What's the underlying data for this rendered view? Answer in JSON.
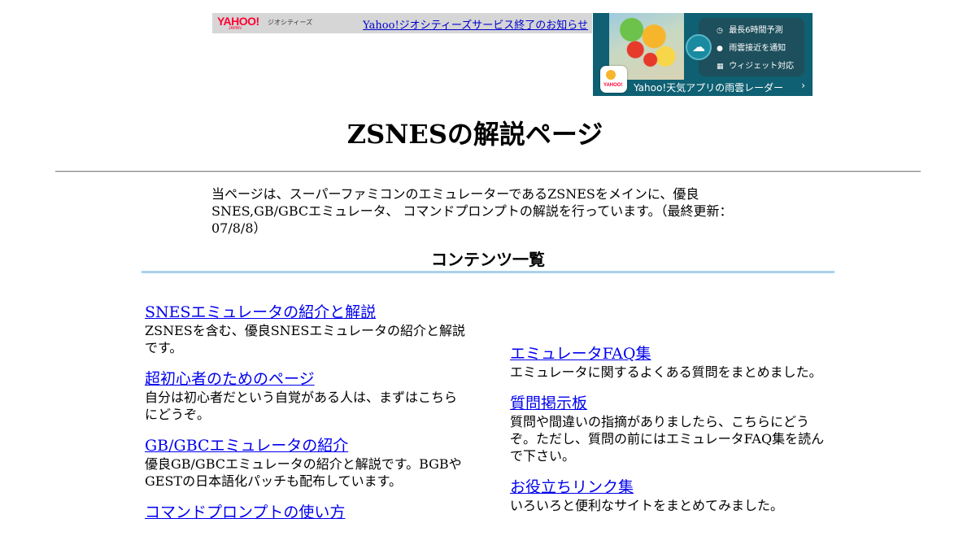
{
  "geocities_bar": {
    "logo_text": "YAHOO!",
    "logo_sub": "JAPAN",
    "logo_service": "ジオシティーズ",
    "notice_link": "Yahoo!ジオシティーズサービス終了のお知らせ"
  },
  "ad": {
    "features": [
      {
        "icon": "clock-icon",
        "glyph": "◷",
        "label": "最長6時間予測"
      },
      {
        "icon": "pin-icon",
        "glyph": "●",
        "label": "雨雲接近を通知"
      },
      {
        "icon": "widget-icon",
        "glyph": "▦",
        "label": "ウィジェット対応"
      }
    ],
    "app_icon_label": "YAHOO!",
    "cta": "Yahoo!天気アプリの雨雲レーダー",
    "chevron": "›"
  },
  "page": {
    "title": "ZSNESの解説ページ",
    "intro": "当ページは、スーパーファミコンのエミュレーターであるZSNESをメインに、優良SNES,GB/GBCエミュレータ、 コマンドプロンプトの解説を行っています。（最終更新：07/8/8）",
    "contents_heading": "コンテンツ一覧"
  },
  "contents": {
    "left": [
      {
        "link": "SNESエミュレータの紹介と解説",
        "desc": "ZSNESを含む、優良SNESエミュレータの紹介と解説です。"
      },
      {
        "link": "超初心者のためのページ",
        "desc": "自分は初心者だという自覚がある人は、まずはこちらにどうぞ。"
      },
      {
        "link": "GB/GBCエミュレータの紹介",
        "desc": "優良GB/GBCエミュレータの紹介と解説です。BGBやGESTの日本語化パッチも配布しています。"
      },
      {
        "link": "コマンドプロンプトの使い方",
        "desc": ""
      }
    ],
    "right": [
      {
        "link": "エミュレータFAQ集",
        "desc": "エミュレータに関するよくある質問をまとめました。"
      },
      {
        "link": "質問掲示板",
        "desc": "質問や間違いの指摘がありましたら、こちらにどうぞ。ただし、質問の前にはエミュレータFAQ集を読んで下さい。"
      },
      {
        "link": "お役立ちリンク集",
        "desc": "いろいろと便利なサイトをまとめてみました。"
      }
    ]
  },
  "colors": {
    "link": "#0000ee",
    "contents_rule": "#a9d0ea",
    "geo_bar_bg": "#d6d6d6",
    "ad_bg": "#0e6072"
  }
}
